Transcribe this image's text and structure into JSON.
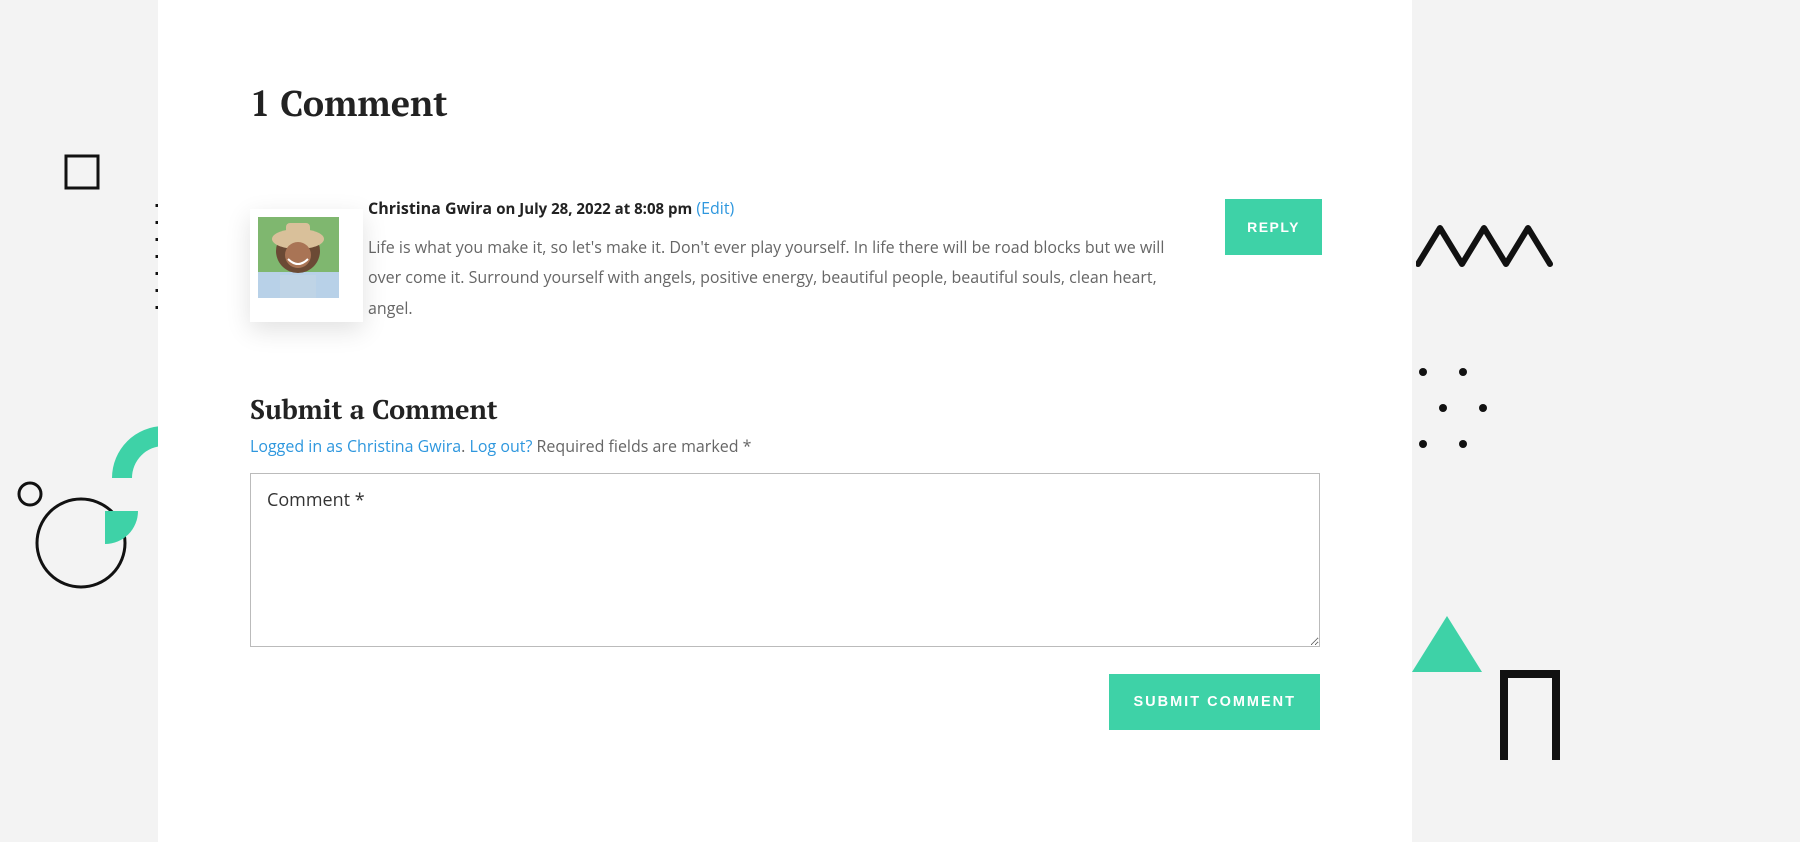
{
  "comments": {
    "title": "1 Comment",
    "items": [
      {
        "author": "Christina Gwira",
        "when": "on July 28, 2022 at 8:08 pm",
        "edit_label": "(Edit)",
        "body": "Life is what you make it, so let's make it. Don't ever play yourself. In life there will be road blocks but we will over come it. Surround yourself with angels, positive energy, beautiful people, beautiful souls, clean heart, angel.",
        "reply_label": "REPLY"
      }
    ]
  },
  "form": {
    "title": "Submit a Comment",
    "logged_in_text": "Logged in as Christina Gwira",
    "logged_in_sep": ". ",
    "logout_text": "Log out?",
    "required_fields_text": " Required fields are marked *",
    "comment_placeholder": "Comment *",
    "submit_label": "SUBMIT COMMENT"
  },
  "colors": {
    "accent": "#3ed2a7",
    "link": "#2e97de"
  }
}
